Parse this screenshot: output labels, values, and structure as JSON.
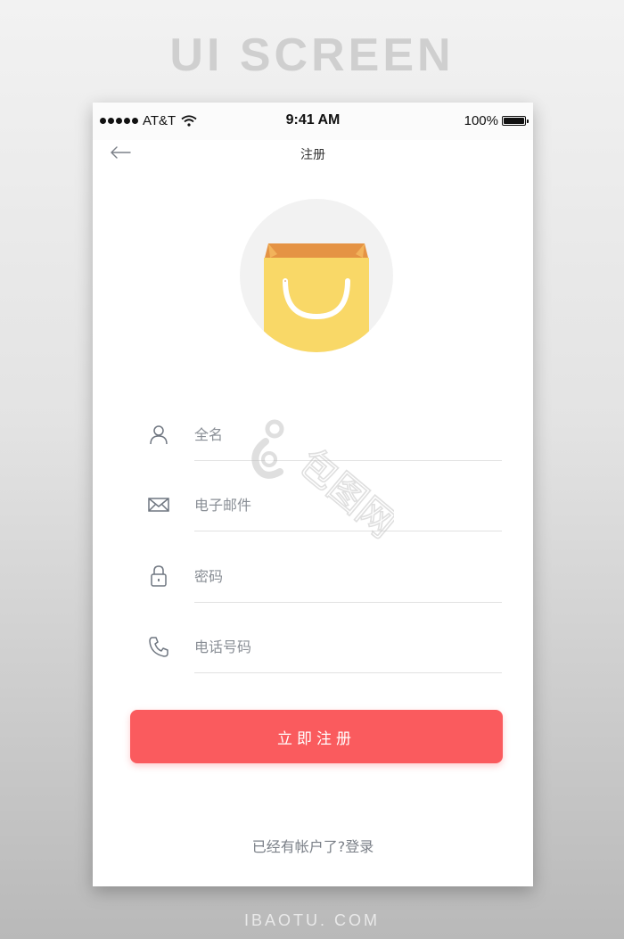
{
  "banner": {
    "title": "UI SCREEN"
  },
  "footer": {
    "watermark": "IBAOTU. COM"
  },
  "status_bar": {
    "carrier": "AT&T",
    "time": "9:41 AM",
    "battery": "100%"
  },
  "nav": {
    "title": "注册",
    "back_icon": "arrow-left-icon"
  },
  "logo": {
    "icon": "shopping-bag-icon",
    "bag_color": "#f9d867",
    "flap_color": "#e59344"
  },
  "form": {
    "fields": [
      {
        "icon": "user-icon",
        "placeholder": "全名",
        "value": ""
      },
      {
        "icon": "mail-icon",
        "placeholder": "电子邮件",
        "value": ""
      },
      {
        "icon": "lock-icon",
        "placeholder": "密码",
        "value": ""
      },
      {
        "icon": "phone-icon",
        "placeholder": "电话号码",
        "value": ""
      }
    ]
  },
  "actions": {
    "submit_label": "立即注册",
    "login_prompt": "已经有帐户了?登录"
  },
  "colors": {
    "accent": "#fa5b5e",
    "text_muted": "#8a8f96"
  },
  "watermark": {
    "text": "包图网"
  }
}
